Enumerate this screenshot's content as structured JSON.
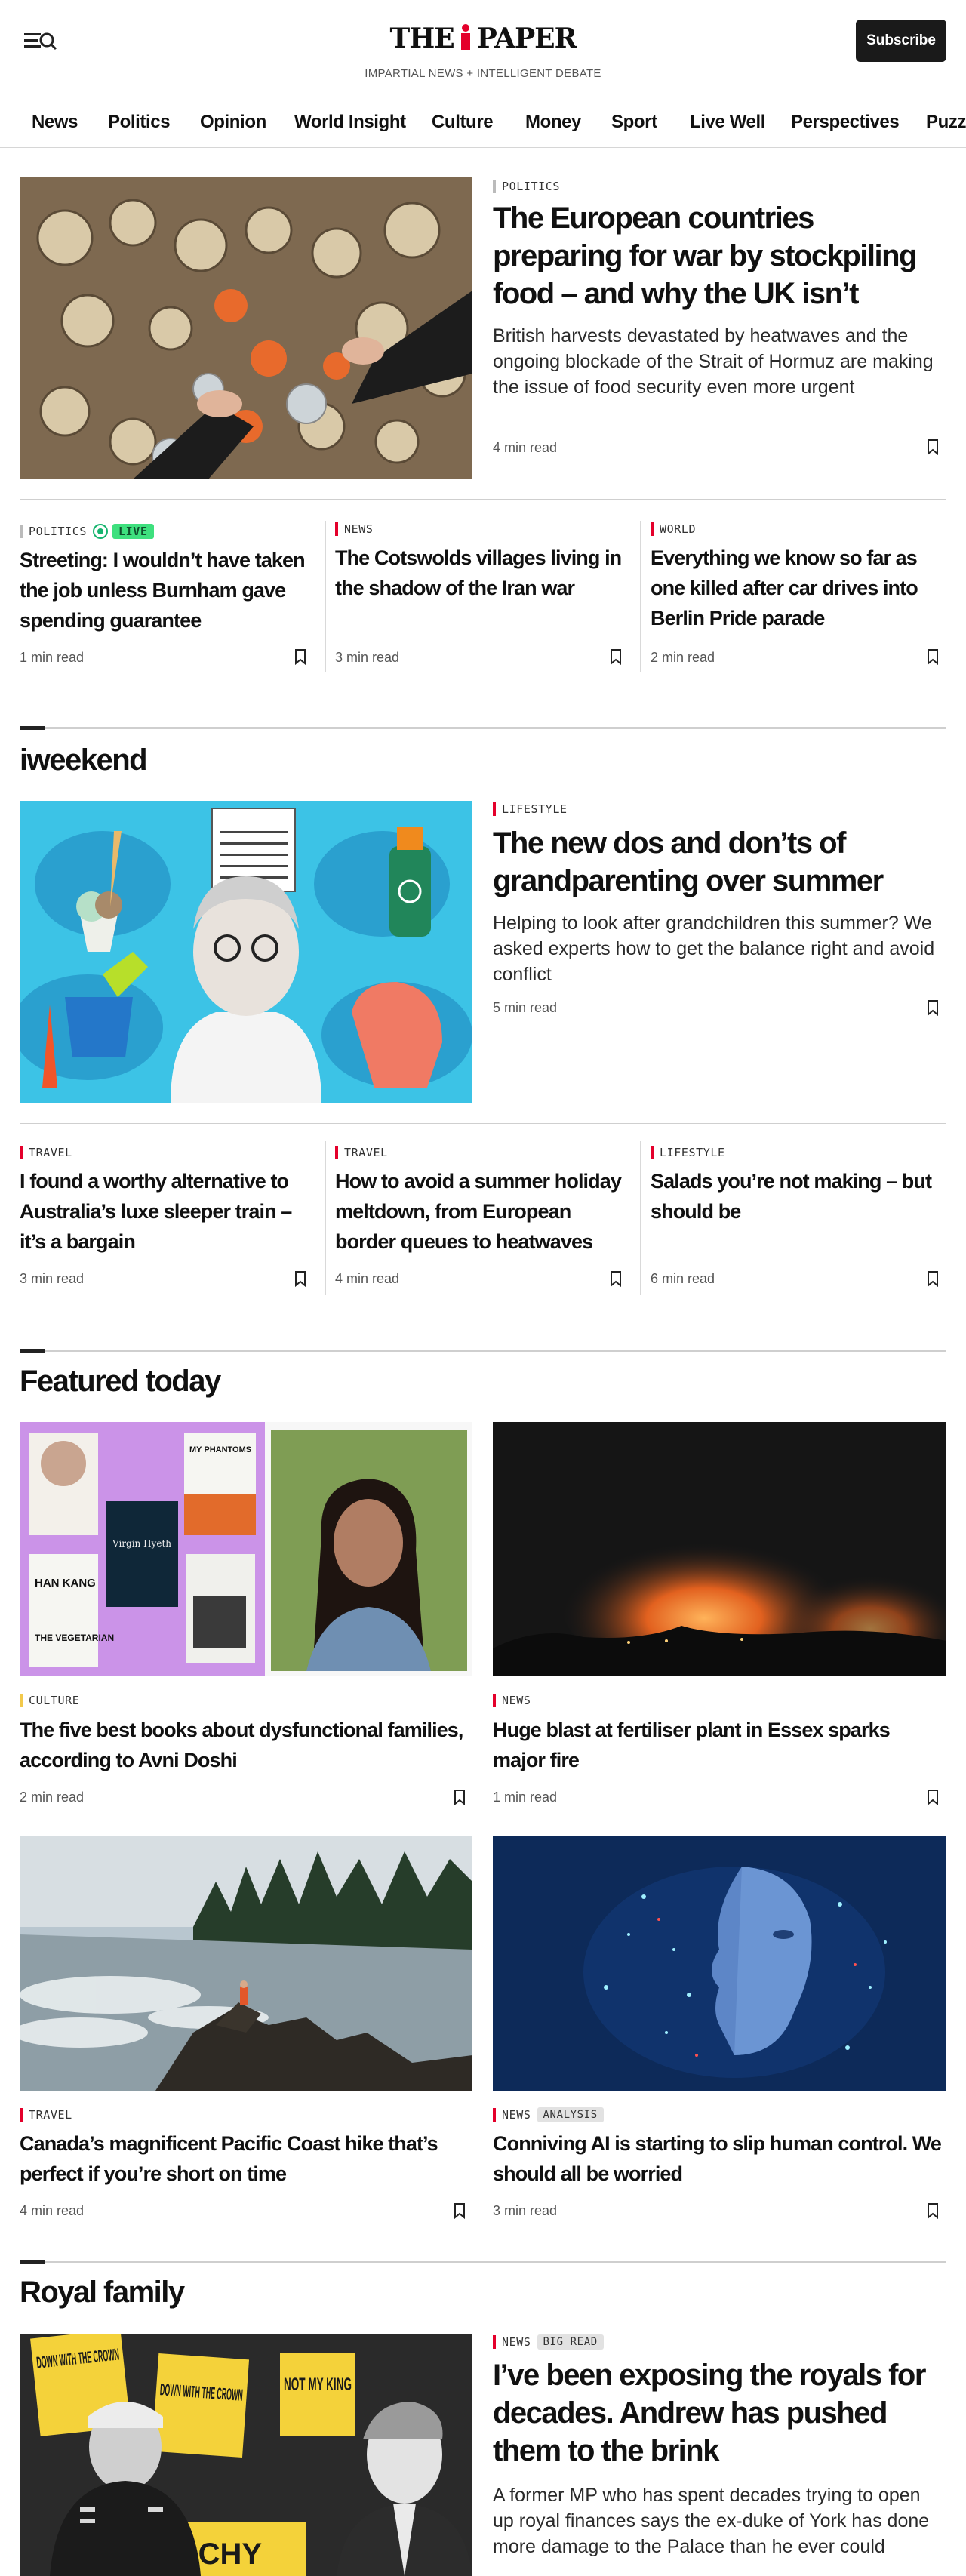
{
  "header": {
    "logo_left": "THE",
    "logo_right": "PAPER",
    "tagline": "IMPARTIAL NEWS + INTELLIGENT DEBATE",
    "subscribe_label": "Subscribe",
    "menu_icon": "menu-search-icon"
  },
  "nav": [
    "News",
    "Politics",
    "Opinion",
    "World Insight",
    "Culture",
    "Money",
    "Sport",
    "Live Well",
    "Perspectives",
    "Puzzles"
  ],
  "lead": {
    "label": "POLITICS",
    "headline": "The European countries preparing for war by stockpiling food – and why the UK isn’t",
    "standfirst": "British harvests devastated by heatwaves and the ongoing blockade of the Strait of Hormuz are making the issue of food security even more urgent",
    "read_time": "4 min read"
  },
  "row1": [
    {
      "label": "POLITICS",
      "live": "LIVE",
      "headline": "Streeting: I wouldn’t have taken the job unless Burnham gave spending guarantee",
      "read_time": "1 min read"
    },
    {
      "label": "NEWS",
      "headline": "The Cotswolds villages living in the shadow of the Iran war",
      "read_time": "3 min read"
    },
    {
      "label": "WORLD",
      "headline": "Everything we know so far as one killed after car drives into Berlin Pride parade",
      "read_time": "2 min read"
    }
  ],
  "iweekend": {
    "title": "iweekend",
    "lead": {
      "label": "LIFESTYLE",
      "headline": "The new dos and don’ts of grandparenting over summer",
      "standfirst": "Helping to look after grandchildren this summer? We asked experts how to get the balance right and avoid conflict",
      "read_time": "5 min read"
    },
    "row": [
      {
        "label": "TRAVEL",
        "headline": "I found a worthy alternative to Australia’s luxe sleeper train – it’s a bargain",
        "read_time": "3 min read"
      },
      {
        "label": "TRAVEL",
        "headline": "How to avoid a summer holiday meltdown, from European border queues to heatwaves",
        "read_time": "4 min read"
      },
      {
        "label": "LIFESTYLE",
        "headline": "Salads you’re not making – but should be",
        "read_time": "6 min read"
      }
    ]
  },
  "featured": {
    "title": "Featured today",
    "cards": [
      {
        "label": "CULTURE",
        "headline": "The five best books about dysfunctional families, according to Avni Doshi",
        "read_time": "2 min read",
        "book1": "HAN KANG",
        "book2": "THE VEGETARIAN",
        "book3": "MY PHANTOMS",
        "book4": "Virgin Hyeth"
      },
      {
        "label": "NEWS",
        "headline": "Huge blast at fertiliser plant in Essex sparks major fire",
        "read_time": "1 min read"
      },
      {
        "label": "TRAVEL",
        "headline": "Canada’s magnificent Pacific Coast hike that’s perfect if you’re short on time",
        "read_time": "4 min read"
      },
      {
        "label": "NEWS",
        "badge": "ANALYSIS",
        "headline": "Conniving AI is starting to slip human control. We should all be worried",
        "read_time": "3 min read"
      }
    ]
  },
  "royal": {
    "title": "Royal family",
    "label": "NEWS",
    "badge": "BIG READ",
    "headline": "I’ve been exposing the royals for decades. Andrew has pushed them to the brink",
    "standfirst": "A former MP who has spent decades trying to open up royal finances says the ex-duke of York has done more damage to the Palace than he ever could",
    "placard1": "DOWN WITH THE CROWN",
    "placard2": "DOWN WITH THE CROWN",
    "placard3": "NOT MY KING",
    "placard4": "ARCHY"
  },
  "colors": {
    "accent": "#e4002b",
    "live": "#3ee07e",
    "politics_bar": "#bbbbbb",
    "culture_bar": "#f2c94c"
  },
  "icons": {
    "bookmark": "bookmark-icon",
    "live": "live-dot-icon"
  }
}
